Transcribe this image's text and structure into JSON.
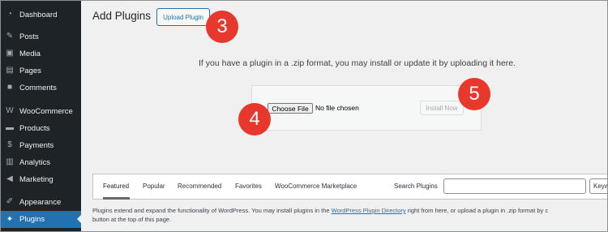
{
  "sidebar": {
    "items": [
      {
        "label": "Dashboard",
        "icon": "dashboard-icon",
        "glyph": "◔"
      },
      {
        "label": "Posts",
        "icon": "pin-icon",
        "glyph": "✎"
      },
      {
        "label": "Media",
        "icon": "media-icon",
        "glyph": "▣"
      },
      {
        "label": "Pages",
        "icon": "page-icon",
        "glyph": "▤"
      },
      {
        "label": "Comments",
        "icon": "comment-icon",
        "glyph": "■"
      },
      {
        "label": "WooCommerce",
        "icon": "woocommerce-icon",
        "glyph": "W"
      },
      {
        "label": "Products",
        "icon": "archive-icon",
        "glyph": "▬"
      },
      {
        "label": "Payments",
        "icon": "dollar-icon",
        "glyph": "$"
      },
      {
        "label": "Analytics",
        "icon": "chart-icon",
        "glyph": "▥"
      },
      {
        "label": "Marketing",
        "icon": "megaphone-icon",
        "glyph": "◀"
      },
      {
        "label": "Appearance",
        "icon": "brush-icon",
        "glyph": "✐"
      },
      {
        "label": "Plugins",
        "icon": "plugin-icon",
        "glyph": "✦"
      }
    ],
    "active": "Plugins"
  },
  "header": {
    "title": "Add Plugins",
    "upload_label": "Upload Plugin"
  },
  "upload": {
    "info": "If you have a plugin in a .zip format, you may install or update it by uploading it here.",
    "choose_label": "Choose File",
    "no_file": "No file chosen",
    "install_label": "Install Now"
  },
  "badges": {
    "b3": "3",
    "b4": "4",
    "b5": "5"
  },
  "filter": {
    "tabs": [
      "Featured",
      "Popular",
      "Recommended",
      "Favorites",
      "WooCommerce Marketplace"
    ],
    "search_label": "Search Plugins",
    "search_value": "",
    "search_type": "Keyw"
  },
  "description": {
    "before": "Plugins extend and expand the functionality of WordPress. You may install plugins in the ",
    "link": "WordPress Plugin Directory",
    "after": " right from here, or upload a plugin in .zip format by c",
    "line2": "button at the top of this page."
  },
  "colors": {
    "sidebar_bg": "#1d2327",
    "active_bg": "#2271b1",
    "badge": "#e8382e"
  }
}
